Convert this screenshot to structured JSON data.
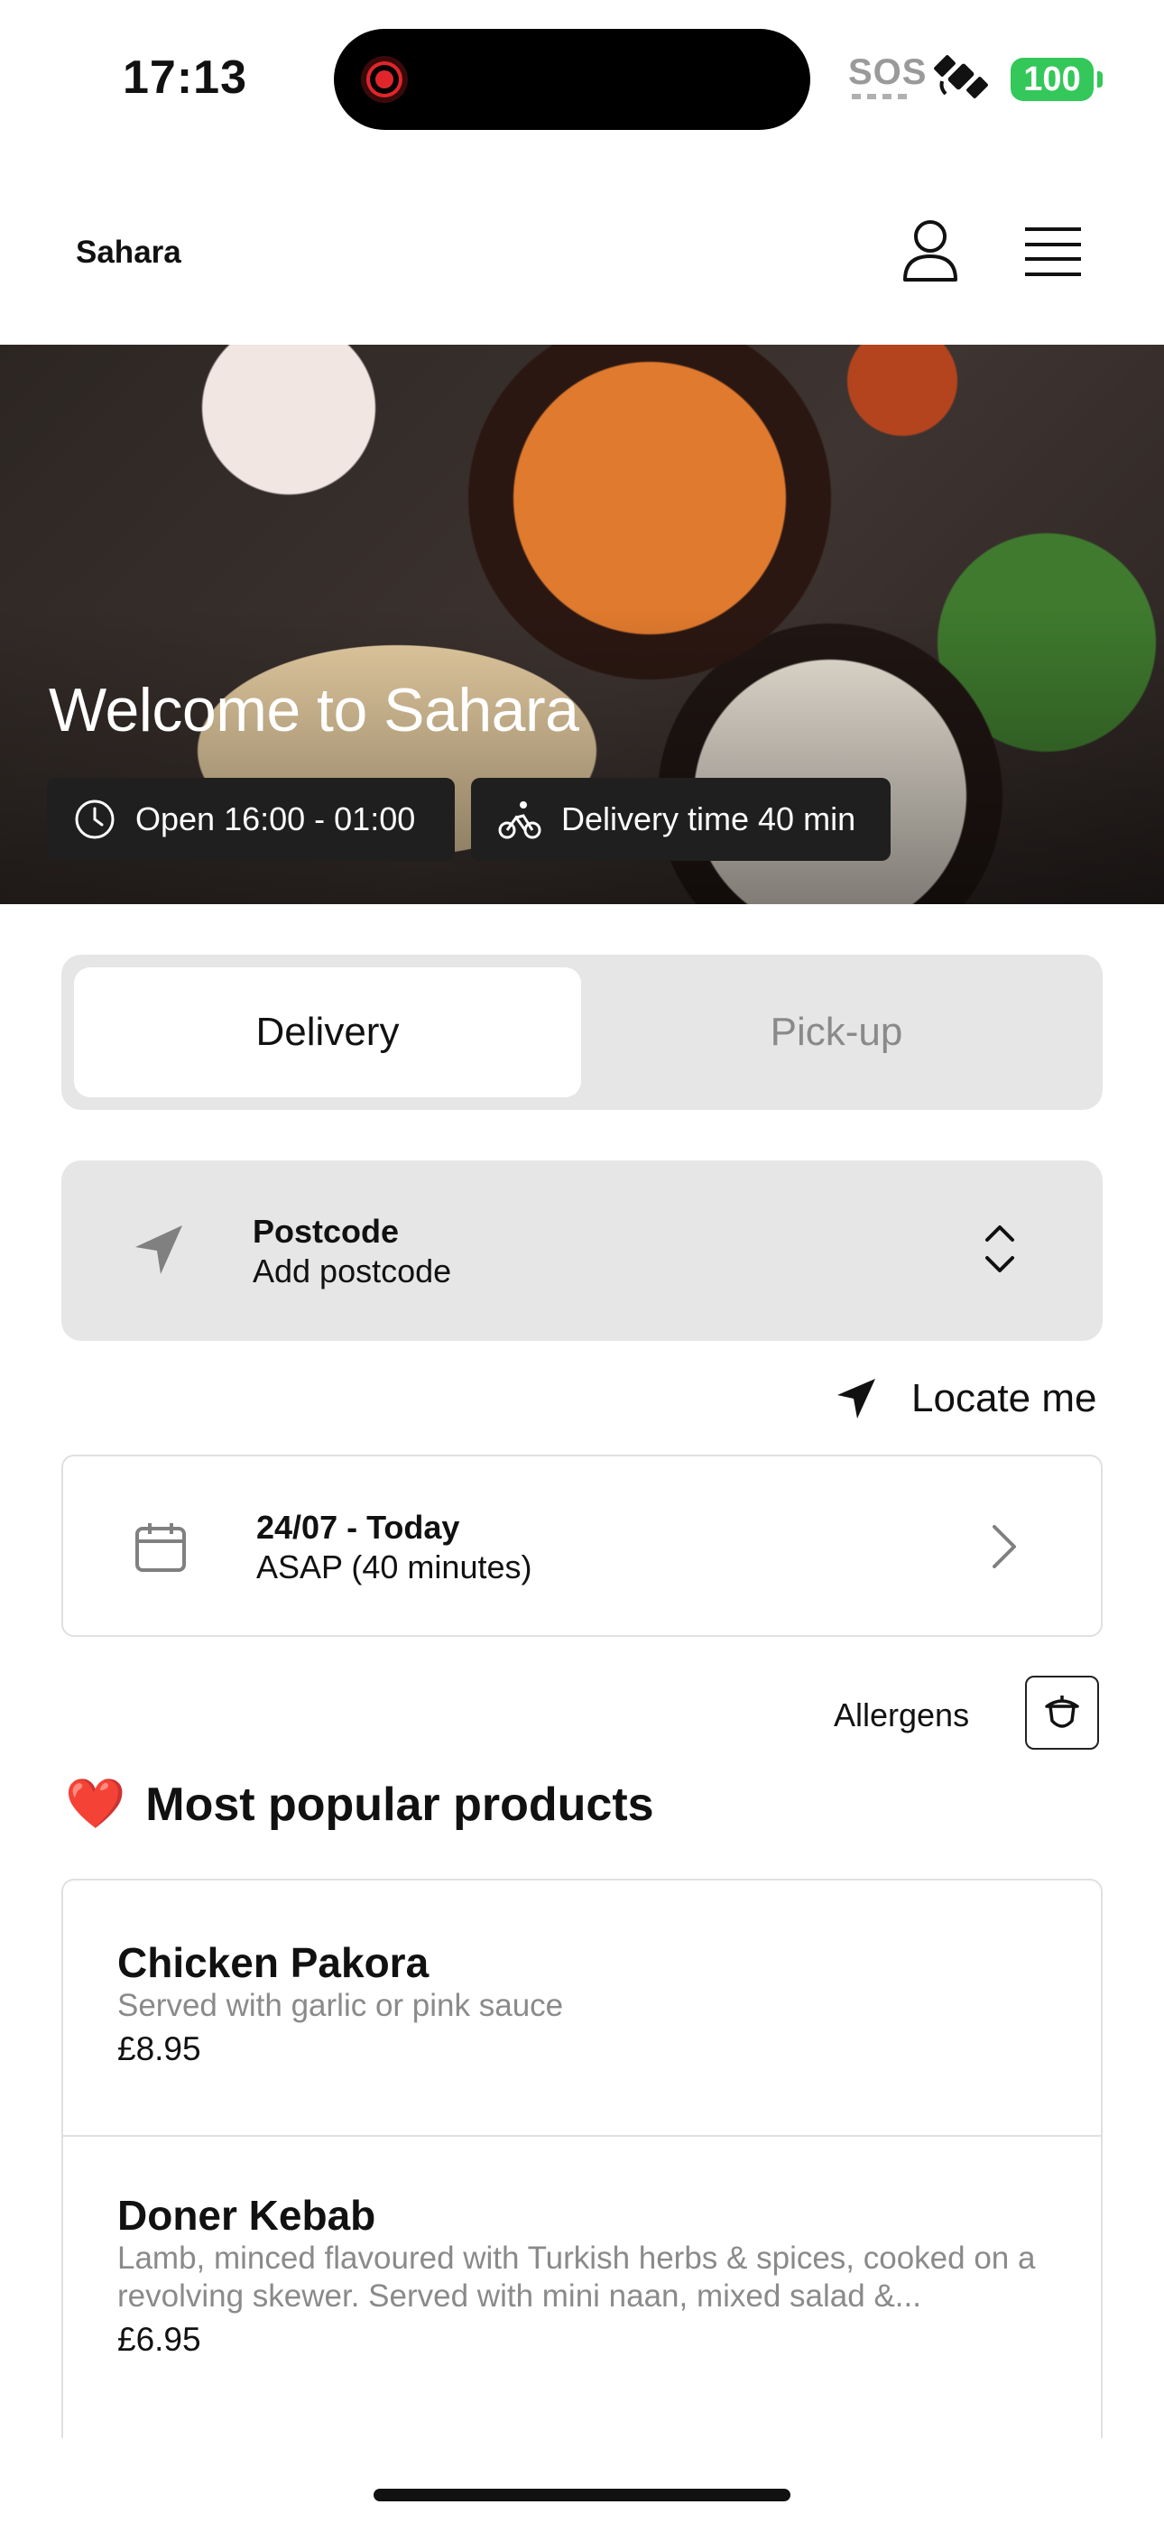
{
  "status_bar": {
    "time": "17:13",
    "sos": "SOS",
    "battery": "100",
    "icons": [
      "screen-recording-icon",
      "satellite-icon",
      "battery-icon"
    ]
  },
  "header": {
    "brand": "Sahara",
    "icons": [
      "user-icon",
      "hamburger-menu-icon"
    ]
  },
  "hero": {
    "title": "Welcome to Sahara",
    "open_hours": "Open 16:00 - 01:00",
    "delivery_time": "Delivery time 40 min"
  },
  "order_type": {
    "options": [
      "Delivery",
      "Pick-up"
    ],
    "selected": "Delivery"
  },
  "postcode": {
    "label": "Postcode",
    "value": "Add postcode"
  },
  "locate": {
    "label": "Locate me"
  },
  "schedule": {
    "date": "24/07 - Today",
    "time": "ASAP (40 minutes)"
  },
  "allergens": {
    "label": "Allergens"
  },
  "popular": {
    "emoji": "❤️",
    "title": "Most popular products",
    "products": [
      {
        "name": "Chicken Pakora",
        "description": "Served with garlic or pink sauce",
        "price": "£8.95"
      },
      {
        "name": "Doner Kebab",
        "description": "Lamb, minced flavoured with Turkish herbs & spices, cooked on a revolving skewer. Served with mini naan, mixed salad &...",
        "price": "£6.95"
      }
    ]
  },
  "colors": {
    "accent_battery": "#34c759",
    "heart": "#e11d2a",
    "panel_bg": "#e6e6e6",
    "muted_text": "#8a8a8a"
  }
}
